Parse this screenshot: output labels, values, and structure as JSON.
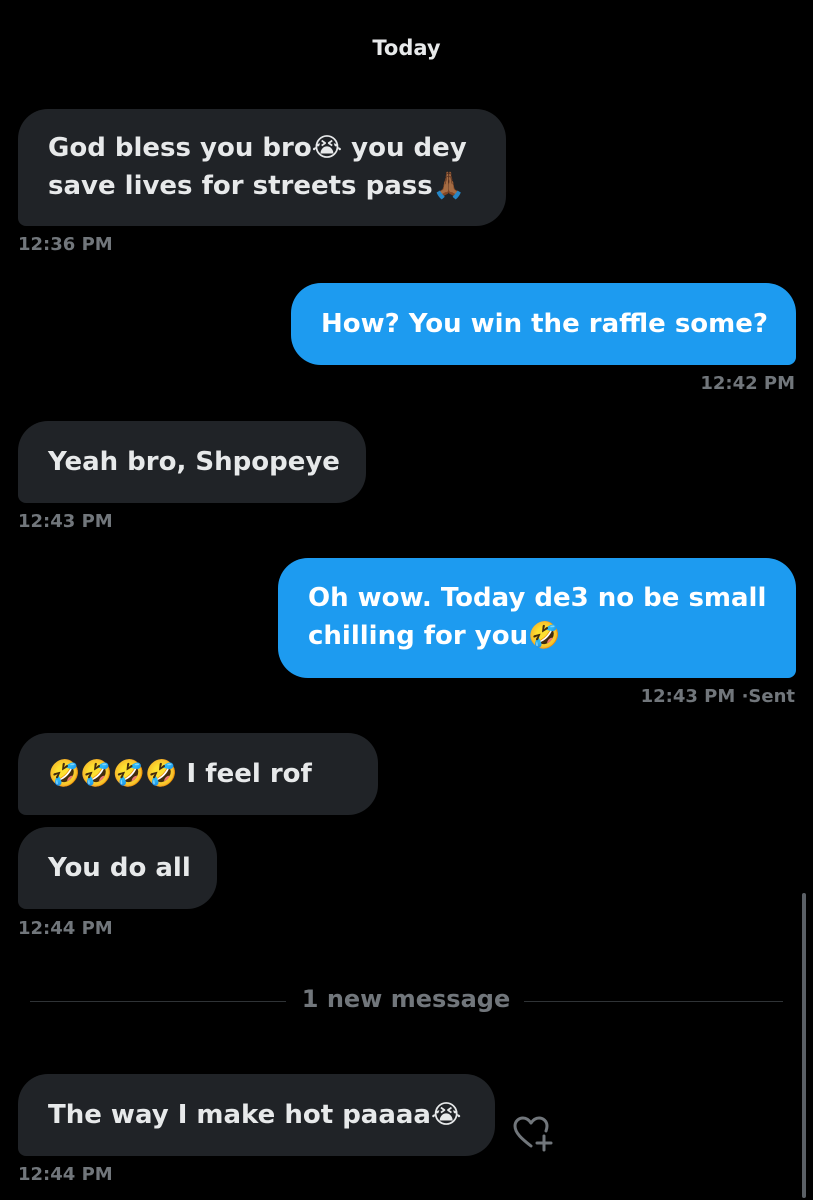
{
  "conversation": {
    "day_label": "Today",
    "new_messages_divider": "1 new message",
    "sent_status": "Sent",
    "accent_color": "#1d9bf0",
    "incoming_color": "#202327",
    "messages": [
      {
        "direction": "incoming",
        "text_line1": "God bless you bro",
        "emoji1": "😭",
        "text_line1b": " you dey",
        "text_line2": "save lives for streets pass",
        "emoji2": "🙏🏾",
        "time": "12:36 PM"
      },
      {
        "direction": "outgoing",
        "text": "How? You win the raffle some?",
        "time": "12:42 PM"
      },
      {
        "direction": "incoming",
        "text": "Yeah bro, Shpopeye",
        "time": "12:43 PM"
      },
      {
        "direction": "outgoing",
        "text_line1": "Oh wow. Today de3 no be small",
        "text_line2": "chilling for you",
        "emoji": "🤣",
        "time": "12:43 PM"
      },
      {
        "direction": "incoming",
        "emojis": "🤣🤣🤣🤣",
        "text": " I feel rof"
      },
      {
        "direction": "incoming",
        "text": "You do all",
        "time": "12:44 PM"
      },
      {
        "direction": "incoming",
        "text": "The way I make hot paaaa",
        "emoji": "😭",
        "time": "12:44 PM"
      }
    ]
  },
  "icons": {
    "react": "heart-plus-icon"
  }
}
